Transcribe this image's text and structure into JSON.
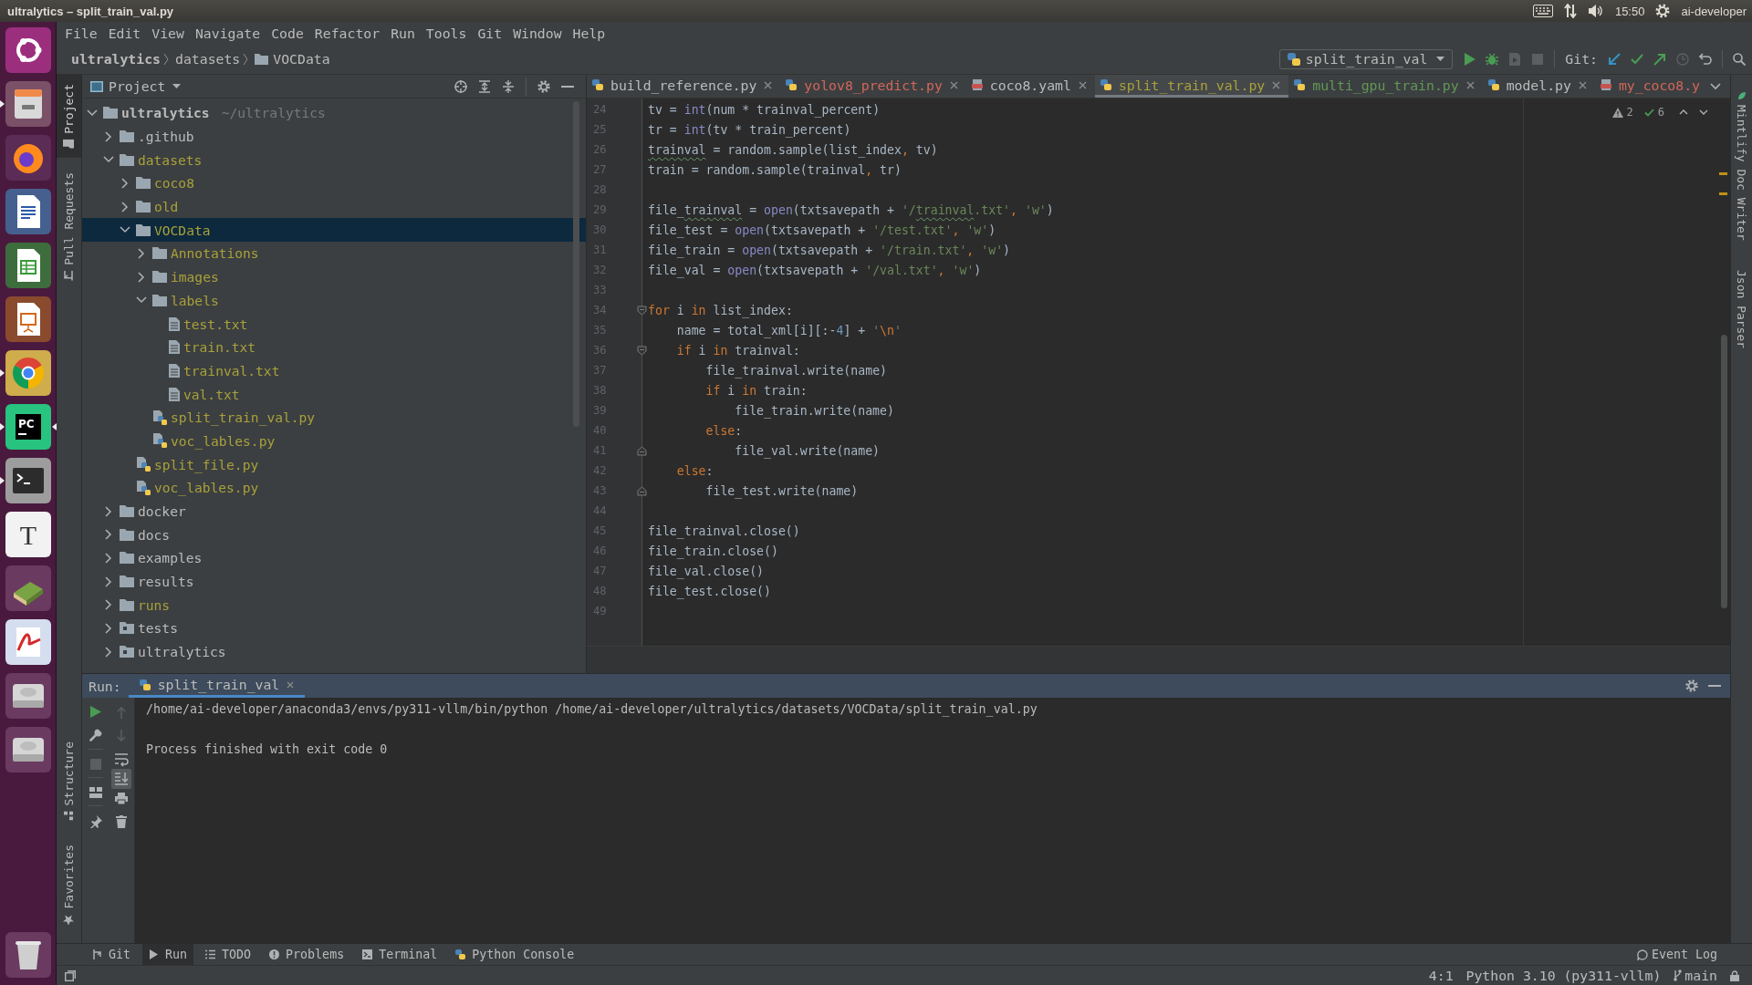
{
  "top_bar": {
    "title": "ultralytics – split_train_val.py",
    "clock": "15:50",
    "user": "ai-developer"
  },
  "launcher": [
    {
      "kind": "dash",
      "running": false,
      "focused": false
    },
    {
      "kind": "files",
      "running": true,
      "focused": false
    },
    {
      "kind": "firefox",
      "running": false,
      "focused": false
    },
    {
      "kind": "writer",
      "running": false,
      "focused": false
    },
    {
      "kind": "calc",
      "running": false,
      "focused": false
    },
    {
      "kind": "impress",
      "running": false,
      "focused": false
    },
    {
      "kind": "chrome",
      "running": true,
      "focused": false
    },
    {
      "kind": "pycharm",
      "label": "PC",
      "running": true,
      "focused": true
    },
    {
      "kind": "terminal",
      "running": true,
      "focused": false
    },
    {
      "kind": "typora",
      "label": "T",
      "running": false,
      "focused": false
    },
    {
      "kind": "books",
      "running": false,
      "focused": false
    },
    {
      "kind": "reader",
      "running": false,
      "focused": false
    },
    {
      "kind": "drive",
      "running": false,
      "focused": false
    },
    {
      "kind": "drive",
      "running": false,
      "focused": false
    },
    {
      "kind": "trash",
      "running": false,
      "focused": false
    }
  ],
  "menu": [
    "File",
    "Edit",
    "View",
    "Navigate",
    "Code",
    "Refactor",
    "Run",
    "Tools",
    "Git",
    "Window",
    "Help"
  ],
  "nav_bar": {
    "breadcrumbs": [
      "ultralytics",
      "datasets",
      "VOCData"
    ],
    "run_config": "split_train_val",
    "run_actions": [
      {
        "kind": "run",
        "disabled": false
      },
      {
        "kind": "debug",
        "disabled": false
      },
      {
        "kind": "coverage",
        "disabled": true
      },
      {
        "kind": "stop",
        "disabled": true
      }
    ],
    "vcs_label": "Git:"
  },
  "left_strip": {
    "top": [
      {
        "label": "Project",
        "selected": true
      },
      {
        "label": "Pull Requests",
        "selected": false
      }
    ],
    "bottom": [
      {
        "label": "Structure",
        "selected": false
      },
      {
        "label": "Favorites",
        "selected": false
      }
    ]
  },
  "project": {
    "title": "Project",
    "tree": [
      {
        "label": "ultralytics",
        "hint": "~/ultralytics",
        "kind": "root",
        "expanded": true,
        "selected": false,
        "color": "#bbbbbb",
        "children": [
          {
            "label": ".github",
            "kind": "folder",
            "expanded": false,
            "selected": false,
            "color": "#bbbbbb"
          },
          {
            "label": "datasets",
            "kind": "folder",
            "expanded": true,
            "selected": false,
            "color": "#a8a13a",
            "children": [
              {
                "label": "coco8",
                "kind": "folder",
                "expanded": false,
                "selected": false,
                "color": "#a8a13a"
              },
              {
                "label": "old",
                "kind": "folder",
                "expanded": false,
                "selected": false,
                "color": "#a8a13a"
              },
              {
                "label": "VOCData",
                "kind": "folder",
                "expanded": true,
                "selected": true,
                "color": "#a8a13a",
                "children": [
                  {
                    "label": "Annotations",
                    "kind": "folder",
                    "expanded": false,
                    "selected": false,
                    "color": "#a8a13a"
                  },
                  {
                    "label": "images",
                    "kind": "folder",
                    "expanded": false,
                    "selected": false,
                    "color": "#a8a13a"
                  },
                  {
                    "label": "labels",
                    "kind": "folder",
                    "expanded": true,
                    "selected": false,
                    "color": "#a8a13a",
                    "children": [
                      {
                        "label": "test.txt",
                        "kind": "text-file",
                        "selected": false,
                        "color": "#a8a13a"
                      },
                      {
                        "label": "train.txt",
                        "kind": "text-file",
                        "selected": false,
                        "color": "#a8a13a"
                      },
                      {
                        "label": "trainval.txt",
                        "kind": "text-file",
                        "selected": false,
                        "color": "#a8a13a"
                      },
                      {
                        "label": "val.txt",
                        "kind": "text-file",
                        "selected": false,
                        "color": "#a8a13a"
                      }
                    ]
                  },
                  {
                    "label": "split_train_val.py",
                    "kind": "python-file",
                    "selected": false,
                    "color": "#a8a13a"
                  },
                  {
                    "label": "voc_lables.py",
                    "kind": "python-file",
                    "selected": false,
                    "color": "#a8a13a"
                  }
                ]
              },
              {
                "label": "split_file.py",
                "kind": "python-file",
                "selected": false,
                "color": "#a8a13a"
              },
              {
                "label": "voc_lables.py",
                "kind": "python-file",
                "selected": false,
                "color": "#a8a13a"
              }
            ]
          },
          {
            "label": "docker",
            "kind": "folder",
            "expanded": false,
            "selected": false,
            "color": "#bbbbbb"
          },
          {
            "label": "docs",
            "kind": "folder",
            "expanded": false,
            "selected": false,
            "color": "#bbbbbb"
          },
          {
            "label": "examples",
            "kind": "folder",
            "expanded": false,
            "selected": false,
            "color": "#bbbbbb"
          },
          {
            "label": "results",
            "kind": "folder",
            "expanded": false,
            "selected": false,
            "color": "#bbbbbb"
          },
          {
            "label": "runs",
            "kind": "folder",
            "expanded": false,
            "selected": false,
            "color": "#a8a13a"
          },
          {
            "label": "tests",
            "kind": "module",
            "expanded": false,
            "selected": false,
            "color": "#bbbbbb"
          },
          {
            "label": "ultralytics",
            "kind": "module",
            "expanded": false,
            "selected": false,
            "color": "#bbbbbb"
          }
        ]
      }
    ]
  },
  "editor": {
    "tabs": [
      {
        "label": "build_reference.py",
        "kind": "python",
        "color": "#bbbbbb",
        "selected": false,
        "closable": true
      },
      {
        "label": "yolov8_predict.py",
        "kind": "python",
        "color": "#d1675a",
        "selected": false,
        "closable": true
      },
      {
        "label": "coco8.yaml",
        "kind": "yaml",
        "color": "#bbbbbb",
        "selected": false,
        "closable": true
      },
      {
        "label": "split_train_val.py",
        "kind": "python",
        "color": "#a8a13a",
        "selected": true,
        "closable": true
      },
      {
        "label": "multi_gpu_train.py",
        "kind": "python",
        "color": "#629755",
        "selected": false,
        "closable": true
      },
      {
        "label": "model.py",
        "kind": "python",
        "color": "#bbbbbb",
        "selected": false,
        "closable": true
      },
      {
        "label": "my_coco8.y",
        "kind": "yaml",
        "color": "#d1675a",
        "selected": false,
        "closable": false
      }
    ],
    "inspections": {
      "warnings": "2",
      "passed": "6"
    },
    "lines": [
      {
        "number": "24",
        "kind": "plain",
        "tokens": [
          {
            "kind": "plain",
            "text": "tv = "
          },
          {
            "kind": "builtin",
            "text": "int"
          },
          {
            "kind": "plain",
            "text": "(num * trainval_percent)"
          }
        ]
      },
      {
        "number": "25",
        "kind": "plain",
        "tokens": [
          {
            "kind": "plain",
            "text": "tr = "
          },
          {
            "kind": "builtin",
            "text": "int"
          },
          {
            "kind": "plain",
            "text": "(tv * train_percent)"
          }
        ]
      },
      {
        "number": "26",
        "kind": "plain",
        "tokens": [
          {
            "kind": "typo",
            "text": "trainval"
          },
          {
            "kind": "plain",
            "text": " = random.sample(list_index"
          },
          {
            "kind": "punct",
            "text": ","
          },
          {
            "kind": "plain",
            "text": " tv)"
          }
        ]
      },
      {
        "number": "27",
        "kind": "plain",
        "tokens": [
          {
            "kind": "plain",
            "text": "train = random.sample(trainval"
          },
          {
            "kind": "punct",
            "text": ","
          },
          {
            "kind": "plain",
            "text": " tr)"
          }
        ]
      },
      {
        "number": "28",
        "kind": "plain"
      },
      {
        "number": "29",
        "kind": "plain",
        "tokens": [
          {
            "kind": "plain",
            "text": "file_"
          },
          {
            "kind": "typo",
            "text": "trainval"
          },
          {
            "kind": "plain",
            "text": " = "
          },
          {
            "kind": "builtin",
            "text": "open"
          },
          {
            "kind": "plain",
            "text": "(txtsavepath + "
          },
          {
            "kind": "string",
            "text": "'/"
          },
          {
            "kind": "string-typo",
            "text": "trainval"
          },
          {
            "kind": "string",
            "text": ".txt'"
          },
          {
            "kind": "punct",
            "text": ","
          },
          {
            "kind": "string",
            "text": " 'w'"
          },
          {
            "kind": "plain",
            "text": ")"
          }
        ]
      },
      {
        "number": "30",
        "kind": "plain",
        "tokens": [
          {
            "kind": "plain",
            "text": "file_test = "
          },
          {
            "kind": "builtin",
            "text": "open"
          },
          {
            "kind": "plain",
            "text": "(txtsavepath + "
          },
          {
            "kind": "string",
            "text": "'/test.txt'"
          },
          {
            "kind": "punct",
            "text": ","
          },
          {
            "kind": "string",
            "text": " 'w'"
          },
          {
            "kind": "plain",
            "text": ")"
          }
        ]
      },
      {
        "number": "31",
        "kind": "plain",
        "tokens": [
          {
            "kind": "plain",
            "text": "file_train = "
          },
          {
            "kind": "builtin",
            "text": "open"
          },
          {
            "kind": "plain",
            "text": "(txtsavepath + "
          },
          {
            "kind": "string",
            "text": "'/train.txt'"
          },
          {
            "kind": "punct",
            "text": ","
          },
          {
            "kind": "string",
            "text": " 'w'"
          },
          {
            "kind": "plain",
            "text": ")"
          }
        ]
      },
      {
        "number": "32",
        "kind": "plain",
        "tokens": [
          {
            "kind": "plain",
            "text": "file_val = "
          },
          {
            "kind": "builtin",
            "text": "open"
          },
          {
            "kind": "plain",
            "text": "(txtsavepath + "
          },
          {
            "kind": "string",
            "text": "'/val.txt'"
          },
          {
            "kind": "punct",
            "text": ","
          },
          {
            "kind": "string",
            "text": " 'w'"
          },
          {
            "kind": "plain",
            "text": ")"
          }
        ]
      },
      {
        "number": "33",
        "kind": "plain"
      },
      {
        "number": "34",
        "kind": "fold-start",
        "tokens": [
          {
            "kind": "keyword",
            "text": "for"
          },
          {
            "kind": "plain",
            "text": " i "
          },
          {
            "kind": "keyword",
            "text": "in"
          },
          {
            "kind": "plain",
            "text": " list_index:"
          }
        ]
      },
      {
        "number": "35",
        "kind": "plain",
        "tokens": [
          {
            "kind": "plain",
            "text": "    name = total_xml[i][:-"
          },
          {
            "kind": "number",
            "text": "4"
          },
          {
            "kind": "plain",
            "text": "] + "
          },
          {
            "kind": "string",
            "text": "'"
          },
          {
            "kind": "escape",
            "text": "\\n"
          },
          {
            "kind": "string",
            "text": "'"
          }
        ]
      },
      {
        "number": "36",
        "kind": "fold-start",
        "tokens": [
          {
            "kind": "keyword",
            "text": "    if"
          },
          {
            "kind": "plain",
            "text": " i "
          },
          {
            "kind": "keyword",
            "text": "in"
          },
          {
            "kind": "plain",
            "text": " trainval:"
          }
        ]
      },
      {
        "number": "37",
        "kind": "plain",
        "tokens": [
          {
            "kind": "plain",
            "text": "        file_trainval.write(name)"
          }
        ]
      },
      {
        "number": "38",
        "kind": "plain",
        "tokens": [
          {
            "kind": "keyword",
            "text": "        if"
          },
          {
            "kind": "plain",
            "text": " i "
          },
          {
            "kind": "keyword",
            "text": "in"
          },
          {
            "kind": "plain",
            "text": " train:"
          }
        ]
      },
      {
        "number": "39",
        "kind": "plain",
        "tokens": [
          {
            "kind": "plain",
            "text": "            file_train.write(name)"
          }
        ]
      },
      {
        "number": "40",
        "kind": "plain",
        "tokens": [
          {
            "kind": "keyword",
            "text": "        else"
          },
          {
            "kind": "plain",
            "text": ":"
          }
        ]
      },
      {
        "number": "41",
        "kind": "fold-end",
        "tokens": [
          {
            "kind": "plain",
            "text": "            file_val.write(name)"
          }
        ]
      },
      {
        "number": "42",
        "kind": "plain",
        "tokens": [
          {
            "kind": "keyword",
            "text": "    else"
          },
          {
            "kind": "plain",
            "text": ":"
          }
        ]
      },
      {
        "number": "43",
        "kind": "fold-end",
        "tokens": [
          {
            "kind": "plain",
            "text": "        file_test.write(name)"
          }
        ]
      },
      {
        "number": "44",
        "kind": "plain"
      },
      {
        "number": "45",
        "kind": "plain",
        "tokens": [
          {
            "kind": "plain",
            "text": "file_trainval.close()"
          }
        ]
      },
      {
        "number": "46",
        "kind": "plain",
        "tokens": [
          {
            "kind": "plain",
            "text": "file_train.close()"
          }
        ]
      },
      {
        "number": "47",
        "kind": "plain",
        "tokens": [
          {
            "kind": "plain",
            "text": "file_val.close()"
          }
        ]
      },
      {
        "number": "48",
        "kind": "plain",
        "tokens": [
          {
            "kind": "plain",
            "text": "file_test.close()"
          }
        ]
      },
      {
        "number": "49",
        "kind": "plain"
      }
    ]
  },
  "right_strip": [
    "Mintlify Doc Writer",
    "Json Parser"
  ],
  "run_panel": {
    "label": "Run:",
    "tabs": [
      {
        "label": "split_train_val",
        "selected": true
      }
    ],
    "toggles": [
      {
        "kind": "soft-wrap",
        "on": false
      },
      {
        "kind": "scroll-to-end",
        "on": true
      }
    ],
    "output": [
      "/home/ai-developer/anaconda3/envs/py311-vllm/bin/python /home/ai-developer/ultralytics/datasets/VOCData/split_train_val.py",
      "Process finished with exit code 0"
    ]
  },
  "bottom_tabs": [
    {
      "label": "Git",
      "selected": false
    },
    {
      "label": "Run",
      "selected": true
    },
    {
      "label": "TODO",
      "selected": false
    },
    {
      "label": "Problems",
      "selected": false
    },
    {
      "label": "Terminal",
      "selected": false
    },
    {
      "label": "Python Console",
      "selected": false
    }
  ],
  "status_bar": {
    "event_log": "Event Log",
    "position": "4:1",
    "interpreter": "Python 3.10 (py311-vllm)",
    "branch": "main"
  }
}
